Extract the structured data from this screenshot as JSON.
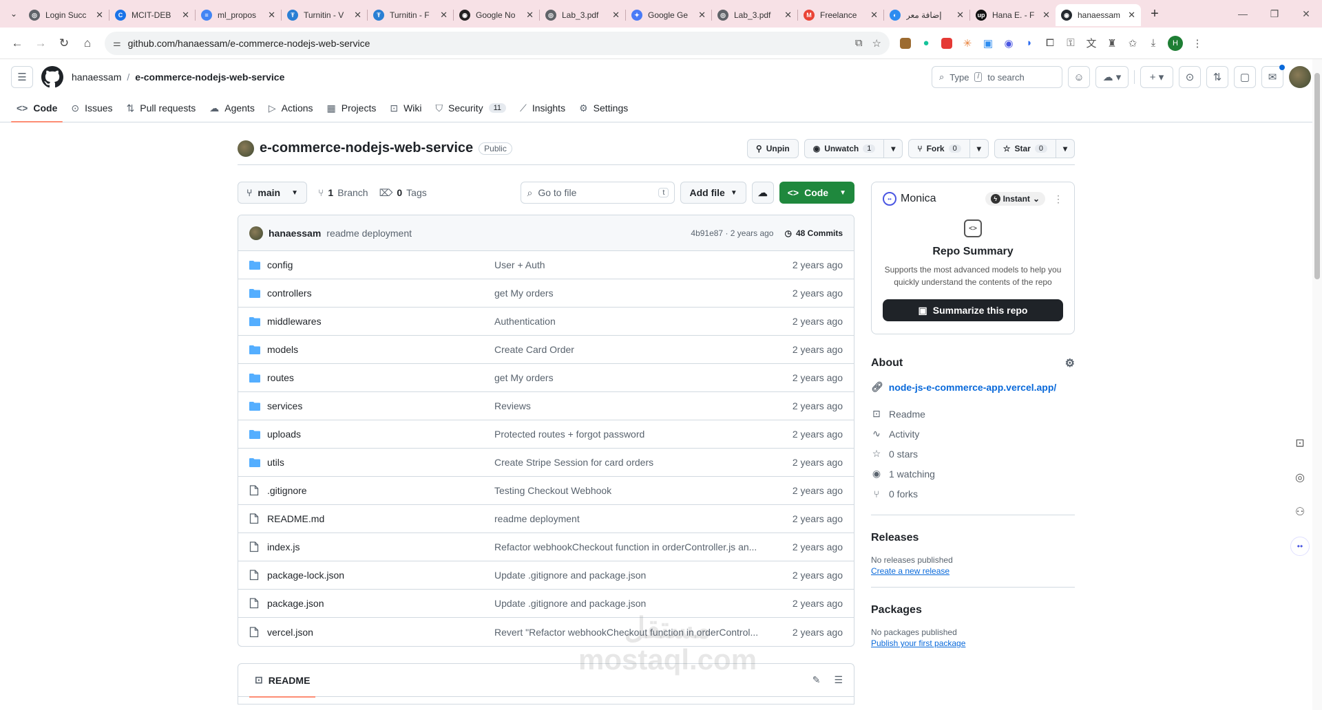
{
  "browser": {
    "tabs": [
      {
        "label": "Login Succ",
        "fav_color": "#5f6368",
        "fav_glyph": "◎"
      },
      {
        "label": "MCIT-DEB",
        "fav_color": "#1a73e8",
        "fav_glyph": "C"
      },
      {
        "label": "ml_propos",
        "fav_color": "#4285f4",
        "fav_glyph": "≡"
      },
      {
        "label": "Turnitin - V",
        "fav_color": "#2a7fd4",
        "fav_glyph": "Ŧ"
      },
      {
        "label": "Turnitin - F",
        "fav_color": "#2a7fd4",
        "fav_glyph": "Ŧ"
      },
      {
        "label": "Google No",
        "fav_color": "#222222",
        "fav_glyph": "◉"
      },
      {
        "label": "Lab_3.pdf",
        "fav_color": "#5f6368",
        "fav_glyph": "◎"
      },
      {
        "label": "Google Ge",
        "fav_color": "#4a7bf7",
        "fav_glyph": "✦"
      },
      {
        "label": "Lab_3.pdf",
        "fav_color": "#5f6368",
        "fav_glyph": "◎"
      },
      {
        "label": "Freelance",
        "fav_color": "#ea4335",
        "fav_glyph": "M"
      },
      {
        "label": "إضافة معر",
        "fav_color": "#2d8cf0",
        "fav_glyph": "◐"
      },
      {
        "label": "Hana E. - F",
        "fav_color": "#111111",
        "fav_glyph": "up"
      },
      {
        "label": "hanaessam",
        "fav_color": "#24292f",
        "fav_glyph": "◉",
        "active": true
      }
    ],
    "url": "github.com/hanaessam/e-commerce-nodejs-web-service",
    "profile_initial": "H"
  },
  "header": {
    "owner": "hanaessam",
    "repo": "e-commerce-nodejs-web-service",
    "search_placeholder_pre": "Type",
    "search_key": "/",
    "search_placeholder_post": "to search"
  },
  "repo_nav": [
    {
      "label": "Code",
      "icon": "code-icon",
      "glyph": "<>",
      "active": true
    },
    {
      "label": "Issues",
      "icon": "issue-icon",
      "glyph": "⊙"
    },
    {
      "label": "Pull requests",
      "icon": "pull-request-icon",
      "glyph": "⇅"
    },
    {
      "label": "Agents",
      "icon": "agents-icon",
      "glyph": "☁"
    },
    {
      "label": "Actions",
      "icon": "play-icon",
      "glyph": "▷"
    },
    {
      "label": "Projects",
      "icon": "table-icon",
      "glyph": "▦"
    },
    {
      "label": "Wiki",
      "icon": "book-icon",
      "glyph": "⊡"
    },
    {
      "label": "Security",
      "icon": "shield-icon",
      "glyph": "⛉",
      "count": "11"
    },
    {
      "label": "Insights",
      "icon": "graph-icon",
      "glyph": "⟋"
    },
    {
      "label": "Settings",
      "icon": "gear-icon",
      "glyph": "⚙"
    }
  ],
  "repo": {
    "title": "e-commerce-nodejs-web-service",
    "visibility": "Public",
    "unpin": "Unpin",
    "unwatch": "Unwatch",
    "watch_count": "1",
    "fork": "Fork",
    "fork_count": "0",
    "star": "Star",
    "star_count": "0"
  },
  "file_toolbar": {
    "branch": "main",
    "branches": "1",
    "branches_label": "Branch",
    "tags": "0",
    "tags_label": "Tags",
    "goto_placeholder": "Go to file",
    "goto_key": "t",
    "add_file": "Add file",
    "code": "Code"
  },
  "last_commit": {
    "author": "hanaessam",
    "message": "readme deployment",
    "meta": "4b91e87 · 2 years ago",
    "commits": "48 Commits"
  },
  "files": [
    {
      "name": "config",
      "type": "dir",
      "message": "User + Auth",
      "date": "2 years ago"
    },
    {
      "name": "controllers",
      "type": "dir",
      "message": "get My orders",
      "date": "2 years ago"
    },
    {
      "name": "middlewares",
      "type": "dir",
      "message": "Authentication",
      "date": "2 years ago"
    },
    {
      "name": "models",
      "type": "dir",
      "message": "Create Card Order",
      "date": "2 years ago"
    },
    {
      "name": "routes",
      "type": "dir",
      "message": "get My orders",
      "date": "2 years ago"
    },
    {
      "name": "services",
      "type": "dir",
      "message": "Reviews",
      "date": "2 years ago"
    },
    {
      "name": "uploads",
      "type": "dir",
      "message": "Protected routes + forgot password",
      "date": "2 years ago"
    },
    {
      "name": "utils",
      "type": "dir",
      "message": "Create Stripe Session for card orders",
      "date": "2 years ago"
    },
    {
      "name": ".gitignore",
      "type": "file",
      "message": "Testing Checkout Webhook",
      "date": "2 years ago"
    },
    {
      "name": "README.md",
      "type": "file",
      "message": "readme deployment",
      "date": "2 years ago"
    },
    {
      "name": "index.js",
      "type": "file",
      "message": "Refactor webhookCheckout function in orderController.js an...",
      "date": "2 years ago"
    },
    {
      "name": "package-lock.json",
      "type": "file",
      "message": "Update .gitignore and package.json",
      "date": "2 years ago"
    },
    {
      "name": "package.json",
      "type": "file",
      "message": "Update .gitignore and package.json",
      "date": "2 years ago"
    },
    {
      "name": "vercel.json",
      "type": "file",
      "message": "Revert \"Refactor webhookCheckout function in orderControl...",
      "date": "2 years ago"
    }
  ],
  "readme": {
    "label": "README"
  },
  "monica": {
    "name": "Monica",
    "mode": "Instant",
    "title": "Repo Summary",
    "desc": "Supports the most advanced models to help you quickly understand the contents of the repo",
    "button": "Summarize this repo"
  },
  "about": {
    "title": "About",
    "link": "node-js-e-commerce-app.vercel.app/",
    "items": [
      {
        "label": "Readme",
        "icon": "book-icon",
        "glyph": "⊡"
      },
      {
        "label": "Activity",
        "icon": "pulse-icon",
        "glyph": "∿"
      },
      {
        "label": "0 stars",
        "icon": "star-icon",
        "glyph": "☆"
      },
      {
        "label": "1 watching",
        "icon": "eye-icon",
        "glyph": "◉"
      },
      {
        "label": "0 forks",
        "icon": "fork-icon",
        "glyph": "⑂"
      }
    ]
  },
  "releases": {
    "title": "Releases",
    "text": "No releases published",
    "link": "Create a new release"
  },
  "packages": {
    "title": "Packages",
    "text": "No packages published",
    "link": "Publish your first package"
  },
  "watermark": {
    "line1": "مستقل",
    "line2": "mostaql.com"
  },
  "colors": {
    "accent_green": "#1f883d",
    "link_blue": "#0969da",
    "tab_bar": "#f7e1e6",
    "folder_blue": "#54aeff"
  }
}
